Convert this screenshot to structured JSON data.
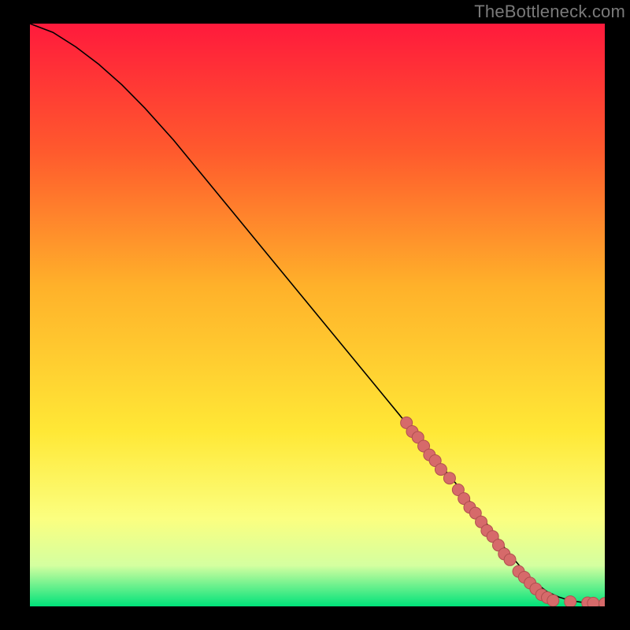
{
  "attribution": "TheBottleneck.com",
  "colors": {
    "frame": "#000000",
    "attribution_text": "#7a7a7a",
    "gradient_top": "#ff1a3c",
    "gradient_mid1": "#ff5a2d",
    "gradient_mid2": "#ffb12a",
    "gradient_mid3": "#ffe836",
    "gradient_mid4": "#fbff80",
    "gradient_mid5": "#d4ffa0",
    "gradient_bottom": "#00e27a",
    "curve": "#000000",
    "marker_fill": "#d66a6a",
    "marker_stroke": "#b04f4f"
  },
  "chart_data": {
    "type": "line",
    "title": "",
    "xlabel": "",
    "ylabel": "",
    "xlim": [
      0,
      100
    ],
    "ylim": [
      0,
      100
    ],
    "curve": {
      "x": [
        0,
        4,
        8,
        12,
        16,
        20,
        25,
        30,
        35,
        40,
        45,
        50,
        55,
        60,
        65,
        70,
        75,
        80,
        83,
        86,
        88,
        90,
        92,
        94,
        96,
        98,
        100
      ],
      "y": [
        100,
        98.5,
        96,
        93,
        89.5,
        85.5,
        80,
        74,
        68,
        62,
        56,
        50,
        44,
        38,
        32,
        26,
        20,
        13.5,
        9.5,
        6,
        4,
        2.5,
        1.6,
        1.0,
        0.7,
        0.55,
        0.5
      ]
    },
    "markers": [
      {
        "x": 65.5,
        "y": 31.5
      },
      {
        "x": 66.5,
        "y": 30.0
      },
      {
        "x": 67.5,
        "y": 29.0
      },
      {
        "x": 68.5,
        "y": 27.5
      },
      {
        "x": 69.5,
        "y": 26.0
      },
      {
        "x": 70.5,
        "y": 25.0
      },
      {
        "x": 71.5,
        "y": 23.5
      },
      {
        "x": 73.0,
        "y": 22.0
      },
      {
        "x": 74.5,
        "y": 20.0
      },
      {
        "x": 75.5,
        "y": 18.5
      },
      {
        "x": 76.5,
        "y": 17.0
      },
      {
        "x": 77.5,
        "y": 16.0
      },
      {
        "x": 78.5,
        "y": 14.5
      },
      {
        "x": 79.5,
        "y": 13.0
      },
      {
        "x": 80.5,
        "y": 12.0
      },
      {
        "x": 81.5,
        "y": 10.5
      },
      {
        "x": 82.5,
        "y": 9.0
      },
      {
        "x": 83.5,
        "y": 8.0
      },
      {
        "x": 85.0,
        "y": 6.0
      },
      {
        "x": 86.0,
        "y": 5.0
      },
      {
        "x": 87.0,
        "y": 4.0
      },
      {
        "x": 88.0,
        "y": 3.0
      },
      {
        "x": 89.0,
        "y": 2.0
      },
      {
        "x": 90.0,
        "y": 1.5
      },
      {
        "x": 91.0,
        "y": 1.0
      },
      {
        "x": 94.0,
        "y": 0.8
      },
      {
        "x": 97.0,
        "y": 0.6
      },
      {
        "x": 98.0,
        "y": 0.55
      },
      {
        "x": 100.0,
        "y": 0.5
      }
    ]
  }
}
